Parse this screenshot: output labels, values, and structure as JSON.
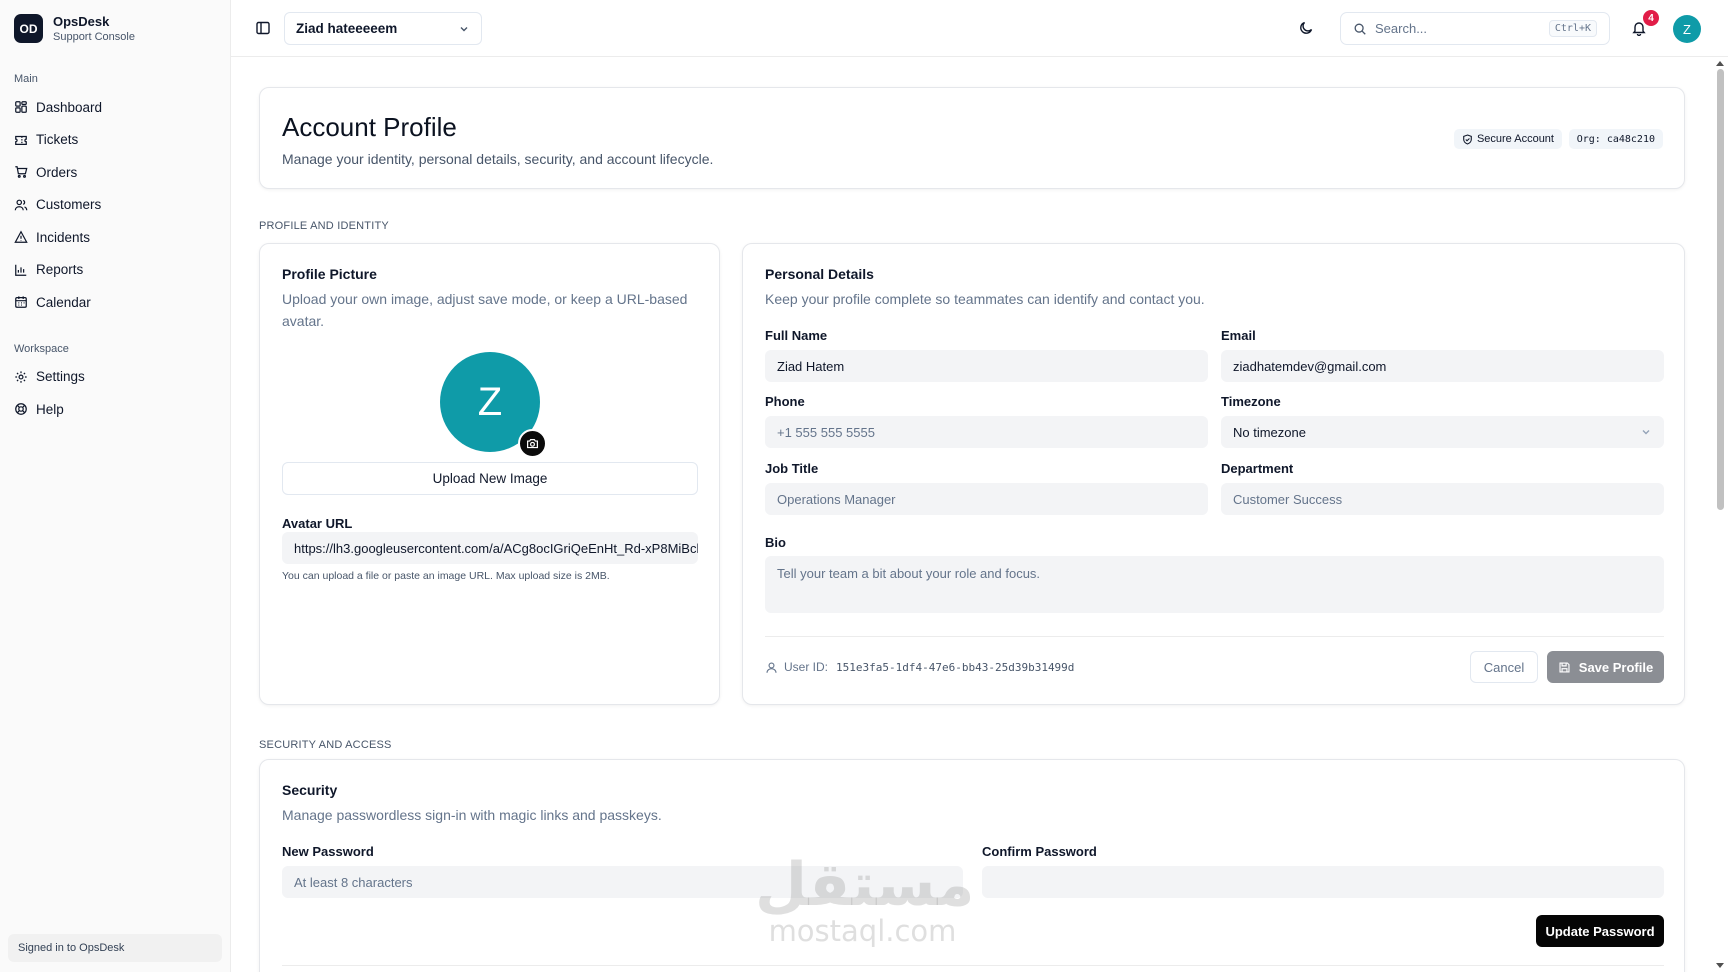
{
  "brand": {
    "logo": "OD",
    "name": "OpsDesk",
    "subtitle": "Support Console"
  },
  "sidebar": {
    "main_label": "Main",
    "main_items": [
      {
        "label": "Dashboard",
        "icon": "layout-grid-icon"
      },
      {
        "label": "Tickets",
        "icon": "ticket-icon"
      },
      {
        "label": "Orders",
        "icon": "cart-icon"
      },
      {
        "label": "Customers",
        "icon": "users-icon"
      },
      {
        "label": "Incidents",
        "icon": "alert-triangle-icon"
      },
      {
        "label": "Reports",
        "icon": "bar-chart-icon"
      },
      {
        "label": "Calendar",
        "icon": "calendar-icon"
      }
    ],
    "workspace_label": "Workspace",
    "workspace_items": [
      {
        "label": "Settings",
        "icon": "gear-icon"
      },
      {
        "label": "Help",
        "icon": "lifebuoy-icon"
      }
    ],
    "footer": "Signed in to OpsDesk"
  },
  "topbar": {
    "workspace": "Ziad hateeeeem",
    "search_placeholder": "Search...",
    "shortcut": "Ctrl+K",
    "notification_count": "4",
    "avatar_initial": "Z"
  },
  "header": {
    "title": "Account Profile",
    "subtitle": "Manage your identity, personal details, security, and account lifecycle.",
    "secure_badge": "Secure Account",
    "org_badge": "Org: ca48c210"
  },
  "sections": {
    "profile": "PROFILE AND IDENTITY",
    "security": "SECURITY AND ACCESS"
  },
  "profile_picture": {
    "title": "Profile Picture",
    "description": "Upload your own image, adjust save mode, or keep a URL-based avatar.",
    "avatar_initial": "Z",
    "upload_button": "Upload New Image",
    "avatar_url_label": "Avatar URL",
    "avatar_url_value": "https://lh3.googleusercontent.com/a/ACg8ocIGriQeEnHt_Rd-xP8MiBch",
    "hint": "You can upload a file or paste an image URL. Max upload size is 2MB."
  },
  "personal_details": {
    "title": "Personal Details",
    "description": "Keep your profile complete so teammates can identify and contact you.",
    "full_name_label": "Full Name",
    "full_name_value": "Ziad Hatem",
    "email_label": "Email",
    "email_value": "ziadhatemdev@gmail.com",
    "phone_label": "Phone",
    "phone_placeholder": "+1 555 555 5555",
    "timezone_label": "Timezone",
    "timezone_value": "No timezone",
    "job_title_label": "Job Title",
    "job_title_placeholder": "Operations Manager",
    "department_label": "Department",
    "department_placeholder": "Customer Success",
    "bio_label": "Bio",
    "bio_placeholder": "Tell your team a bit about your role and focus.",
    "user_id_label": "User ID:",
    "user_id_value": "151e3fa5-1df4-47e6-bb43-25d39b31499d",
    "cancel_button": "Cancel",
    "save_button": "Save Profile"
  },
  "security": {
    "title": "Security",
    "description": "Manage passwordless sign-in with magic links and passkeys.",
    "new_password_label": "New Password",
    "new_password_placeholder": "At least 8 characters",
    "confirm_password_label": "Confirm Password",
    "confirm_password_placeholder": "",
    "update_button": "Update Password"
  },
  "watermark": {
    "arabic": "مستقل",
    "latin": "mostaql.com"
  },
  "colors": {
    "accent": "#0f9ba8",
    "badge": "#e11d48",
    "primary_button": "#050505",
    "disabled_button": "#8b8e94"
  }
}
